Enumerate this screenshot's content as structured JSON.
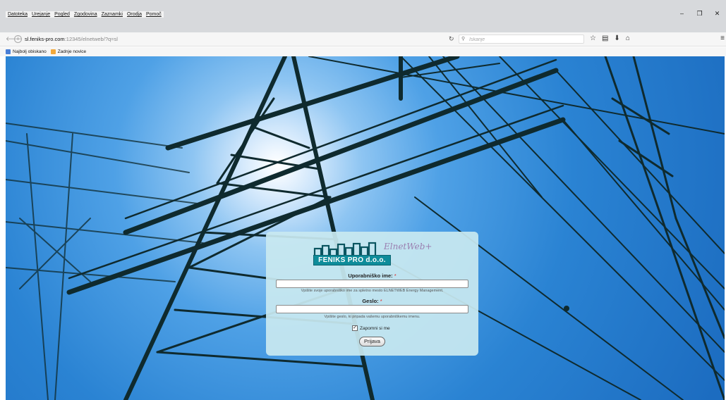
{
  "browser": {
    "menu": [
      "Datoteka",
      "Urejanje",
      "Pogled",
      "Zgodovina",
      "Zaznamki",
      "Orodja",
      "Pomoč"
    ],
    "window_controls": {
      "minimize": "–",
      "restore": "❐",
      "close": "✕"
    },
    "url_host": "sl.feniks-pro.com",
    "url_rest": ":12345/elnetweb/?q=sl",
    "search_placeholder": "Iskanje",
    "bookmarks": [
      {
        "label": "Najbolj obiskano",
        "icon": "bookmark-star-icon",
        "color": "#4a7fd6"
      },
      {
        "label": "Zadnje novice",
        "icon": "folder-icon",
        "color": "#f2a93b"
      }
    ]
  },
  "login": {
    "logo_text": "FENIKS PRO d.o.o.",
    "logo_script": "ElnetWeb+",
    "username_label": "Uporabniško ime:",
    "username_required": "*",
    "username_hint": "Vpišite svoje uporabniško ime za spletno mesto ELNETWEB Energy Management.",
    "password_label": "Geslo:",
    "password_required": "*",
    "password_hint": "Vpišite geslo, ki pripada vašemu uporabniškemu imenu.",
    "remember_label": "Zapomni si me",
    "remember_checked": true,
    "submit_label": "Prijava"
  },
  "colors": {
    "sky": "#2a83d3",
    "panel": "#c8e8f0",
    "logo_band": "#0e8c9a",
    "tower": "#0f2a2e"
  }
}
